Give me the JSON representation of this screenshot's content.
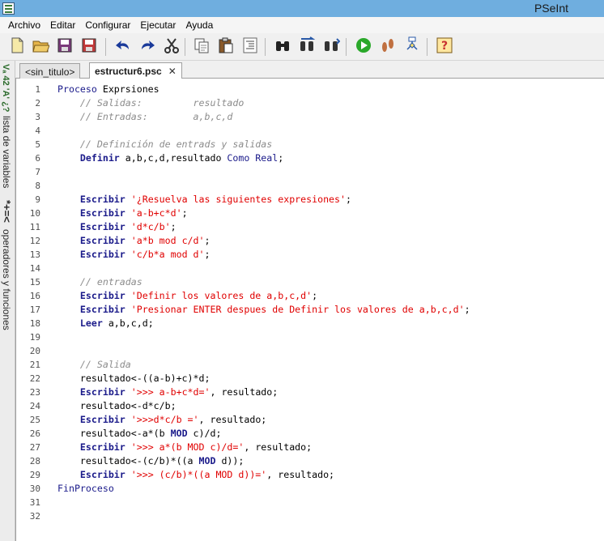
{
  "window": {
    "title": "PSeInt"
  },
  "menu": [
    "Archivo",
    "Editar",
    "Configurar",
    "Ejecutar",
    "Ayuda"
  ],
  "toolbar": {
    "buttons": [
      {
        "name": "new-file-icon",
        "color": "#f5e9a8"
      },
      {
        "name": "open-folder-icon",
        "color": "#e6b54a"
      },
      {
        "name": "save-icon",
        "color": "#7a3a7a"
      },
      {
        "name": "save-as-icon",
        "color": "#c23a3a"
      },
      {
        "name": "undo-icon",
        "color": "#1a3a9a"
      },
      {
        "name": "redo-icon",
        "color": "#1a3a9a"
      },
      {
        "name": "cut-icon",
        "color": "#333333"
      },
      {
        "name": "copy-icon",
        "color": "#555555"
      },
      {
        "name": "paste-icon",
        "color": "#8a5a2a"
      },
      {
        "name": "indent-icon",
        "color": "#666666"
      },
      {
        "name": "find-icon",
        "color": "#222222"
      },
      {
        "name": "replace-icon",
        "color": "#333333"
      },
      {
        "name": "find-next-icon",
        "color": "#333333"
      },
      {
        "name": "run-icon",
        "color": "#2aa82a"
      },
      {
        "name": "step-icon",
        "color": "#c07040"
      },
      {
        "name": "flowchart-icon",
        "color": "#2a5aa8"
      },
      {
        "name": "help-icon",
        "color": "#c83030"
      }
    ]
  },
  "sidepanel": {
    "variables_label": "lista de variables",
    "variables_glyph": "Vₐ 42 'A' ¿?",
    "operators_label": "operadores y funciones",
    "operators_glyph": "*+=<"
  },
  "tabs": [
    {
      "label": "<sin_titulo>",
      "active": false
    },
    {
      "label": "estructur6.psc",
      "active": true,
      "close": "✕"
    }
  ],
  "editor": {
    "lines": [
      {
        "n": "1",
        "tokens": [
          [
            "kw-plain",
            "Proceso "
          ],
          [
            "pname",
            "Exprsiones"
          ]
        ]
      },
      {
        "n": "2",
        "tokens": [
          [
            "cmt",
            "    // Salidas:         resultado"
          ]
        ]
      },
      {
        "n": "3",
        "tokens": [
          [
            "cmt",
            "    // Entradas:        a,b,c,d"
          ]
        ]
      },
      {
        "n": "4",
        "tokens": []
      },
      {
        "n": "5",
        "tokens": [
          [
            "cmt",
            "    // Definición de entrads y salidas"
          ]
        ]
      },
      {
        "n": "6",
        "tokens": [
          [
            "kw",
            "    Definir "
          ],
          [
            "pname",
            "a,b,c,d,resultado "
          ],
          [
            "kw-plain",
            "Como Real"
          ],
          [
            "pname",
            ";"
          ]
        ]
      },
      {
        "n": "7",
        "tokens": []
      },
      {
        "n": "8",
        "tokens": []
      },
      {
        "n": "9",
        "tokens": [
          [
            "kw",
            "    Escribir "
          ],
          [
            "str",
            "'¿Resuelva las siguientes expresiones'"
          ],
          [
            "pname",
            ";"
          ]
        ]
      },
      {
        "n": "10",
        "tokens": [
          [
            "kw",
            "    Escribir "
          ],
          [
            "str",
            "'a-b+c*d'"
          ],
          [
            "pname",
            ";"
          ]
        ]
      },
      {
        "n": "11",
        "tokens": [
          [
            "kw",
            "    Escribir "
          ],
          [
            "str",
            "'d*c/b'"
          ],
          [
            "pname",
            ";"
          ]
        ]
      },
      {
        "n": "12",
        "tokens": [
          [
            "kw",
            "    Escribir "
          ],
          [
            "str",
            "'a*b mod c/d'"
          ],
          [
            "pname",
            ";"
          ]
        ]
      },
      {
        "n": "13",
        "tokens": [
          [
            "kw",
            "    Escribir "
          ],
          [
            "str",
            "'c/b*a mod d'"
          ],
          [
            "pname",
            ";"
          ]
        ]
      },
      {
        "n": "14",
        "tokens": []
      },
      {
        "n": "15",
        "tokens": [
          [
            "cmt",
            "    // entradas"
          ]
        ]
      },
      {
        "n": "16",
        "tokens": [
          [
            "kw",
            "    Escribir "
          ],
          [
            "str",
            "'Definir los valores de a,b,c,d'"
          ],
          [
            "pname",
            ";"
          ]
        ]
      },
      {
        "n": "17",
        "tokens": [
          [
            "kw",
            "    Escribir "
          ],
          [
            "str",
            "'Presionar ENTER despues de Definir los valores de a,b,c,d'"
          ],
          [
            "pname",
            ";"
          ]
        ]
      },
      {
        "n": "18",
        "tokens": [
          [
            "kw",
            "    Leer "
          ],
          [
            "pname",
            "a,b,c,d;"
          ]
        ]
      },
      {
        "n": "19",
        "tokens": []
      },
      {
        "n": "20",
        "tokens": []
      },
      {
        "n": "21",
        "tokens": [
          [
            "cmt",
            "    // Salida"
          ]
        ]
      },
      {
        "n": "22",
        "tokens": [
          [
            "pname",
            "    resultado<-((a-b)+c)*d;"
          ]
        ]
      },
      {
        "n": "23",
        "tokens": [
          [
            "kw",
            "    Escribir "
          ],
          [
            "str",
            "'>>> a-b+c*d='"
          ],
          [
            "pname",
            ", resultado;"
          ]
        ]
      },
      {
        "n": "24",
        "tokens": [
          [
            "pname",
            "    resultado<-d*c/b;"
          ]
        ]
      },
      {
        "n": "25",
        "tokens": [
          [
            "kw",
            "    Escribir "
          ],
          [
            "str",
            "'>>>d*c/b ='"
          ],
          [
            "pname",
            ", resultado;"
          ]
        ]
      },
      {
        "n": "26",
        "tokens": [
          [
            "pname",
            "    resultado<-a*(b "
          ],
          [
            "kw",
            "MOD"
          ],
          [
            "pname",
            " c)/d;"
          ]
        ]
      },
      {
        "n": "27",
        "tokens": [
          [
            "kw",
            "    Escribir "
          ],
          [
            "str",
            "'>>> a*(b MOD c)/d='"
          ],
          [
            "pname",
            ", resultado;"
          ]
        ]
      },
      {
        "n": "28",
        "tokens": [
          [
            "pname",
            "    resultado<-(c/b)*((a "
          ],
          [
            "kw",
            "MOD"
          ],
          [
            "pname",
            " d));"
          ]
        ]
      },
      {
        "n": "29",
        "tokens": [
          [
            "kw",
            "    Escribir "
          ],
          [
            "str",
            "'>>> (c/b)*((a MOD d))='"
          ],
          [
            "pname",
            ", resultado;"
          ]
        ]
      },
      {
        "n": "30",
        "tokens": [
          [
            "kw-plain",
            "FinProceso"
          ]
        ]
      },
      {
        "n": "31",
        "tokens": []
      },
      {
        "n": "32",
        "tokens": []
      }
    ]
  }
}
